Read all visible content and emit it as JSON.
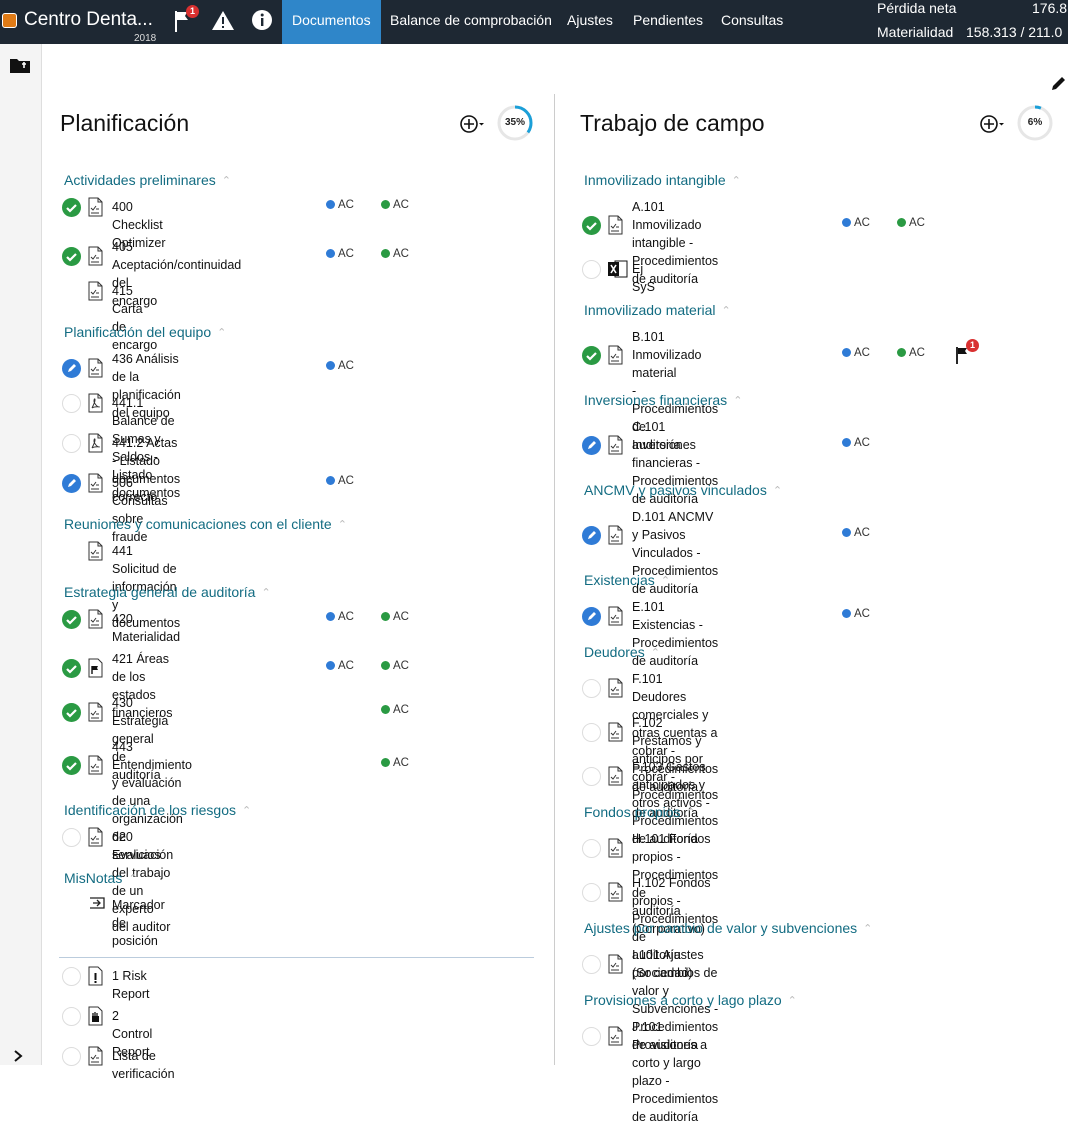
{
  "topbar": {
    "client": "Centro Denta...",
    "year": "2018",
    "flag_count": "1",
    "nav": [
      "Documentos",
      "Balance de comprobación",
      "Ajustes",
      "Pendientes",
      "Consultas"
    ],
    "net_loss_label": "Pérdida neta",
    "net_loss_value": "176.8",
    "materiality_label": "Materialidad",
    "materiality_value": "158.313 / 211.0"
  },
  "planning": {
    "title": "Planificación",
    "progress": "35%",
    "progress_fraction": 0.35,
    "sections": [
      {
        "name": "Actividades preliminares",
        "items": [
          {
            "title": "400 Checklist Optimizer",
            "status": "ok",
            "doc": "form",
            "ac1": "AC",
            "ac2": "AC"
          },
          {
            "title": "405 Aceptación/continuidad del encargo",
            "status": "ok",
            "doc": "form",
            "ac1": "AC",
            "ac2": "AC"
          },
          {
            "title": "415 Carta de encargo",
            "status": "none",
            "doc": "form"
          }
        ]
      },
      {
        "name": "Planificación del equipo",
        "items": [
          {
            "title": "436 Análisis de la planificación del equipo",
            "status": "ed",
            "doc": "form",
            "ac1": "AC"
          },
          {
            "title": "441.1 Balance de Sumas y Saldos - Listado documentos",
            "status": "em",
            "doc": "pdf"
          },
          {
            "title": "441.2 Actas - Listado documentos correcto",
            "status": "em",
            "doc": "pdf"
          },
          {
            "title": "506 Consultas sobre fraude",
            "status": "ed",
            "doc": "form",
            "ac1": "AC"
          }
        ]
      },
      {
        "name": "Reuniones y comunicaciones con el cliente",
        "items": [
          {
            "title": "441 Solicitud de información y documentos",
            "status": "none",
            "doc": "form"
          }
        ]
      },
      {
        "name": "Estrategia general de auditoría",
        "items": [
          {
            "title": "420 Materialidad",
            "status": "ok",
            "doc": "form",
            "ac1": "AC",
            "ac2": "AC"
          },
          {
            "title": "421 Áreas de los estados financieros",
            "status": "ok",
            "doc": "flag",
            "ac1": "AC",
            "ac2": "AC"
          },
          {
            "title": "430 Estrategia general de auditoría",
            "status": "ok",
            "doc": "form",
            "ac2": "AC"
          },
          {
            "title": "443 Entendimiento y evaluación de una organización de servicios",
            "status": "ok",
            "doc": "form",
            "ac2": "AC"
          }
        ]
      },
      {
        "name": "Identificación de los riesgos",
        "items": [
          {
            "title": "620 Evaluación del trabajo de un experto del auditor",
            "status": "em",
            "doc": "form"
          }
        ]
      },
      {
        "name": "MisNotas",
        "items": [
          {
            "title": "Marcador de posición",
            "status": "none",
            "doc": "marker"
          }
        ]
      }
    ],
    "extra_items": [
      {
        "title": "1 Risk Report",
        "status": "em",
        "doc": "warn"
      },
      {
        "title": "2 Control Report",
        "status": "em",
        "doc": "hand"
      },
      {
        "title": "Lista de verificación",
        "status": "em",
        "doc": "form"
      }
    ]
  },
  "fieldwork": {
    "title": "Trabajo de campo",
    "progress": "6%",
    "progress_fraction": 0.06,
    "sections": [
      {
        "name": "Inmovilizado intangible",
        "items": [
          {
            "title": "A.101 Inmovilizado intangible - Procedimientos de auditoría",
            "status": "ok",
            "doc": "form",
            "ac1": "AC",
            "ac2": "AC"
          },
          {
            "title": "Ej SyS",
            "status": "em",
            "doc": "excel"
          }
        ]
      },
      {
        "name": "Inmovilizado material",
        "items": [
          {
            "title": "B.101 Inmovilizado material - Procedimientos de auditoría",
            "status": "ok",
            "doc": "form",
            "ac1": "AC",
            "ac2": "AC",
            "flag": "1"
          }
        ]
      },
      {
        "name": "Inversiones financieras",
        "items": [
          {
            "title": "C.101 Inversiones financieras - Procedimientos de auditoría",
            "status": "ed",
            "doc": "form",
            "ac1": "AC"
          }
        ]
      },
      {
        "name": "ANCMV y pasivos vinculados",
        "items": [
          {
            "title": "D.101 ANCMV y Pasivos Vinculados - Procedimientos de auditoría",
            "status": "ed",
            "doc": "form",
            "ac1": "AC"
          }
        ]
      },
      {
        "name": "Existencias",
        "items": [
          {
            "title": "E.101 Existencias - Procedimientos de auditoría",
            "status": "ed",
            "doc": "form",
            "ac1": "AC"
          }
        ]
      },
      {
        "name": "Deudores",
        "items": [
          {
            "title": "F.101 Deudores comerciales y otras cuentas a cobrar - Procedimientos de auditoría",
            "status": "em",
            "doc": "form"
          },
          {
            "title": "F.102 Préstamos y anticipos por cobrar - Procedimientos de auditoría",
            "status": "em",
            "doc": "form"
          },
          {
            "title": "F.103 Gastos anticipados y otros activos - Procedimientos de auditoría",
            "status": "em",
            "doc": "form"
          }
        ]
      },
      {
        "name": "Fondos propios",
        "items": [
          {
            "title": "H.101 Fondos propios - Procedimientos de auditoría (Corporativo)",
            "status": "em",
            "doc": "form"
          },
          {
            "title": "H.102 Fondos propios - Procedimientos de auditoría (Sociedad)",
            "status": "em",
            "doc": "form"
          }
        ]
      },
      {
        "name": "Ajustes por cambio de valor y subvenciones",
        "items": [
          {
            "title": "I.101 Ajustes por cambios de valor y Subvenciones - Procedimientos de auditoría",
            "status": "em",
            "doc": "form"
          }
        ]
      },
      {
        "name": "Provisiones a corto y lago plazo",
        "items": [
          {
            "title": "J.101 Provisiones a corto y largo plazo - Procedimientos de auditoría",
            "status": "em",
            "doc": "form"
          }
        ]
      }
    ]
  }
}
